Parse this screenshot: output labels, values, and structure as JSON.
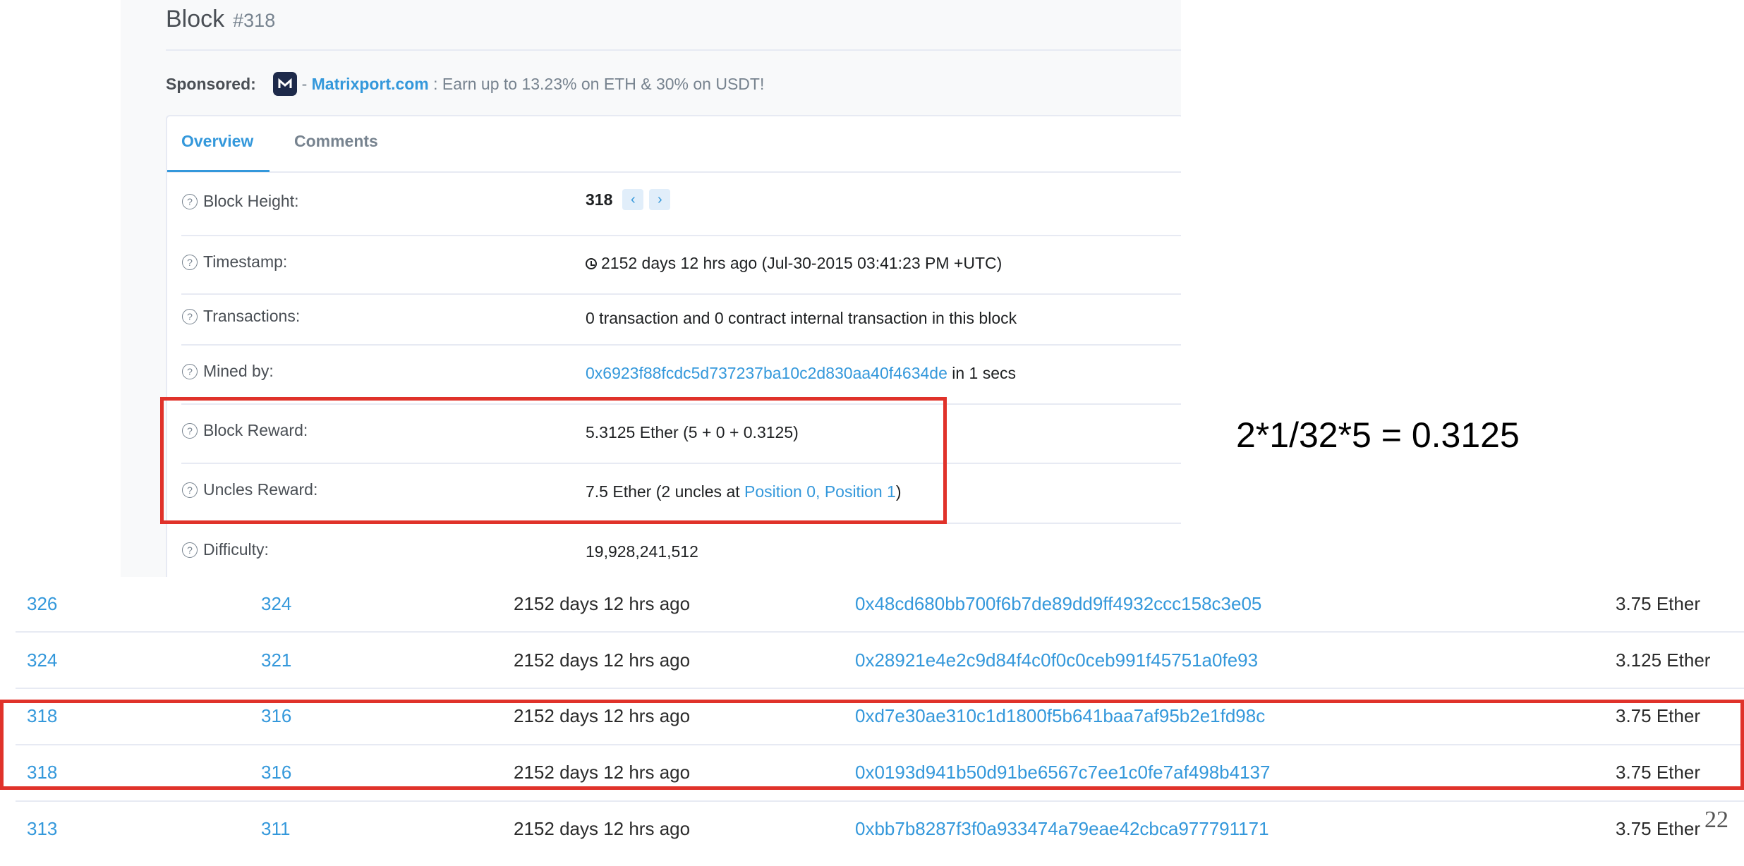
{
  "block": {
    "heading": "Block",
    "number": "#318"
  },
  "sponsor": {
    "label": "Sponsored:",
    "separator": "-",
    "name": "Matrixport.com",
    "text": ": Earn up to 13.23% on ETH & 30% on USDT!"
  },
  "tabs": [
    "Overview",
    "Comments"
  ],
  "overview": {
    "block_height": {
      "label": "Block Height:",
      "value": "318",
      "prev_icon": "chevron-left-icon",
      "next_icon": "chevron-right-icon"
    },
    "timestamp": {
      "label": "Timestamp:",
      "value": "2152 days 12 hrs ago (Jul-30-2015 03:41:23 PM +UTC)"
    },
    "transactions": {
      "label": "Transactions:",
      "value": "0 transaction and 0 contract internal transaction in this block"
    },
    "mined_by": {
      "label": "Mined by:",
      "address": "0x6923f88fcdc5d737237ba10c2d830aa40f4634de",
      "suffix": "in 1 secs"
    },
    "block_reward": {
      "label": "Block Reward:",
      "value": "5.3125 Ether (5 + 0 + 0.3125)"
    },
    "uncles_reward": {
      "label": "Uncles Reward:",
      "prefix": "7.5 Ether (2 uncles at",
      "pos0": "Position 0",
      "comma": ",",
      "pos1": "Position 1",
      "suffix": ")"
    },
    "difficulty": {
      "label": "Difficulty:",
      "value": "19,928,241,512"
    }
  },
  "help_icon": "?",
  "annotation": "2*1/32*5 = 0.3125",
  "uncles": [
    {
      "block": "326",
      "uncle": "324",
      "age": "2152 days 12 hrs ago",
      "miner": "0x48cd680bb700f6b7de89dd9ff4932ccc158c3e05",
      "reward": "3.75 Ether"
    },
    {
      "block": "324",
      "uncle": "321",
      "age": "2152 days 12 hrs ago",
      "miner": "0x28921e4e2c9d84f4c0f0c0ceb991f45751a0fe93",
      "reward": "3.125 Ether"
    },
    {
      "block": "318",
      "uncle": "316",
      "age": "2152 days 12 hrs ago",
      "miner": "0xd7e30ae310c1d1800f5b641baa7af95b2e1fd98c",
      "reward": "3.75 Ether"
    },
    {
      "block": "318",
      "uncle": "316",
      "age": "2152 days 12 hrs ago",
      "miner": "0x0193d941b50d91be6567c7ee1c0fe7af498b4137",
      "reward": "3.75 Ether"
    },
    {
      "block": "313",
      "uncle": "311",
      "age": "2152 days 12 hrs ago",
      "miner": "0xbb7b8287f3f0a933474a79eae42cbca977791171",
      "reward": "3.75 Ether"
    }
  ],
  "page_number": "22",
  "colors": {
    "link": "#3498db",
    "highlight": "#e0322a",
    "panel": "#f8f9fa"
  }
}
